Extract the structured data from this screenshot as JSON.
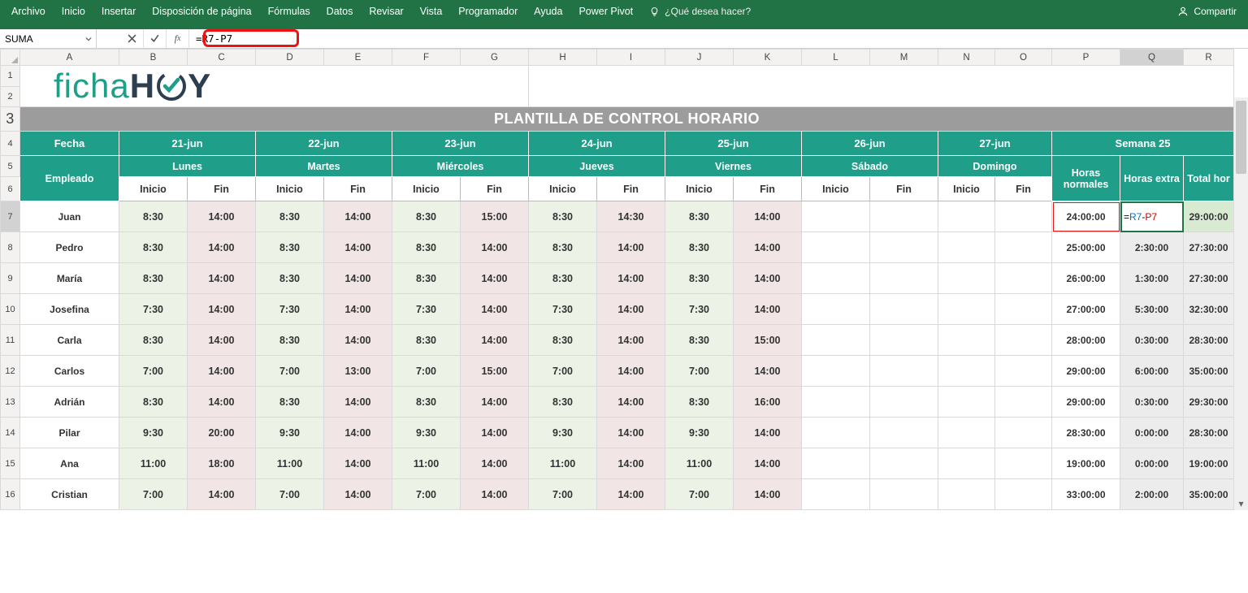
{
  "ribbon": {
    "tabs": [
      "Archivo",
      "Inicio",
      "Insertar",
      "Disposición de página",
      "Fórmulas",
      "Datos",
      "Revisar",
      "Vista",
      "Programador",
      "Ayuda",
      "Power Pivot"
    ],
    "tellMe": "¿Qué desea hacer?",
    "share": "Compartir"
  },
  "formulaBar": {
    "nameBox": "SUMA",
    "formula": "=R7-P7"
  },
  "columns": [
    "A",
    "B",
    "C",
    "D",
    "E",
    "F",
    "G",
    "H",
    "I",
    "J",
    "K",
    "L",
    "M",
    "N",
    "O",
    "P",
    "Q",
    "R"
  ],
  "logo": {
    "part1": "ficha",
    "part2": "H",
    "part3": "Y"
  },
  "title": "PLANTILLA DE CONTROL HORARIO",
  "headerDates": {
    "fecha": "Fecha",
    "dates": [
      "21-jun",
      "22-jun",
      "23-jun",
      "24-jun",
      "25-jun",
      "26-jun",
      "27-jun"
    ],
    "week": "Semana 25"
  },
  "headerDays": {
    "empleado": "Empleado",
    "days": [
      "Lunes",
      "Martes",
      "Miércoles",
      "Jueves",
      "Viernes",
      "Sábado",
      "Domingo"
    ],
    "horasNorm": "Horas normales",
    "horasExtra": "Horas extra",
    "totalHoras": "Total hor"
  },
  "subHeaders": {
    "inicio": "Inicio",
    "fin": "Fin"
  },
  "activeFormulaDisplay": {
    "eq": "=",
    "ref1": "R7",
    "minus": "-",
    "ref2": "P7"
  },
  "rows": [
    {
      "n": "7",
      "emp": "Juan",
      "t": [
        [
          "8:30",
          "14:00"
        ],
        [
          "8:30",
          "14:00"
        ],
        [
          "8:30",
          "15:00"
        ],
        [
          "8:30",
          "14:30"
        ],
        [
          "8:30",
          "14:00"
        ],
        [
          "",
          ""
        ],
        [
          "",
          ""
        ]
      ],
      "hn": "24:00:00",
      "he": "",
      "th": "29:00:00",
      "active": true
    },
    {
      "n": "8",
      "emp": "Pedro",
      "t": [
        [
          "8:30",
          "14:00"
        ],
        [
          "8:30",
          "14:00"
        ],
        [
          "8:30",
          "14:00"
        ],
        [
          "8:30",
          "14:00"
        ],
        [
          "8:30",
          "14:00"
        ],
        [
          "",
          ""
        ],
        [
          "",
          ""
        ]
      ],
      "hn": "25:00:00",
      "he": "2:30:00",
      "th": "27:30:00"
    },
    {
      "n": "9",
      "emp": "María",
      "t": [
        [
          "8:30",
          "14:00"
        ],
        [
          "8:30",
          "14:00"
        ],
        [
          "8:30",
          "14:00"
        ],
        [
          "8:30",
          "14:00"
        ],
        [
          "8:30",
          "14:00"
        ],
        [
          "",
          ""
        ],
        [
          "",
          ""
        ]
      ],
      "hn": "26:00:00",
      "he": "1:30:00",
      "th": "27:30:00"
    },
    {
      "n": "10",
      "emp": "Josefina",
      "t": [
        [
          "7:30",
          "14:00"
        ],
        [
          "7:30",
          "14:00"
        ],
        [
          "7:30",
          "14:00"
        ],
        [
          "7:30",
          "14:00"
        ],
        [
          "7:30",
          "14:00"
        ],
        [
          "",
          ""
        ],
        [
          "",
          ""
        ]
      ],
      "hn": "27:00:00",
      "he": "5:30:00",
      "th": "32:30:00"
    },
    {
      "n": "11",
      "emp": "Carla",
      "t": [
        [
          "8:30",
          "14:00"
        ],
        [
          "8:30",
          "14:00"
        ],
        [
          "8:30",
          "14:00"
        ],
        [
          "8:30",
          "14:00"
        ],
        [
          "8:30",
          "15:00"
        ],
        [
          "",
          ""
        ],
        [
          "",
          ""
        ]
      ],
      "hn": "28:00:00",
      "he": "0:30:00",
      "th": "28:30:00"
    },
    {
      "n": "12",
      "emp": "Carlos",
      "t": [
        [
          "7:00",
          "14:00"
        ],
        [
          "7:00",
          "13:00"
        ],
        [
          "7:00",
          "15:00"
        ],
        [
          "7:00",
          "14:00"
        ],
        [
          "7:00",
          "14:00"
        ],
        [
          "",
          ""
        ],
        [
          "",
          ""
        ]
      ],
      "hn": "29:00:00",
      "he": "6:00:00",
      "th": "35:00:00"
    },
    {
      "n": "13",
      "emp": "Adrián",
      "t": [
        [
          "8:30",
          "14:00"
        ],
        [
          "8:30",
          "14:00"
        ],
        [
          "8:30",
          "14:00"
        ],
        [
          "8:30",
          "14:00"
        ],
        [
          "8:30",
          "16:00"
        ],
        [
          "",
          ""
        ],
        [
          "",
          ""
        ]
      ],
      "hn": "29:00:00",
      "he": "0:30:00",
      "th": "29:30:00"
    },
    {
      "n": "14",
      "emp": "Pilar",
      "t": [
        [
          "9:30",
          "20:00"
        ],
        [
          "9:30",
          "14:00"
        ],
        [
          "9:30",
          "14:00"
        ],
        [
          "9:30",
          "14:00"
        ],
        [
          "9:30",
          "14:00"
        ],
        [
          "",
          ""
        ],
        [
          "",
          ""
        ]
      ],
      "hn": "28:30:00",
      "he": "0:00:00",
      "th": "28:30:00"
    },
    {
      "n": "15",
      "emp": "Ana",
      "t": [
        [
          "11:00",
          "18:00"
        ],
        [
          "11:00",
          "14:00"
        ],
        [
          "11:00",
          "14:00"
        ],
        [
          "11:00",
          "14:00"
        ],
        [
          "11:00",
          "14:00"
        ],
        [
          "",
          ""
        ],
        [
          "",
          ""
        ]
      ],
      "hn": "19:00:00",
      "he": "0:00:00",
      "th": "19:00:00"
    },
    {
      "n": "16",
      "emp": "Cristian",
      "t": [
        [
          "7:00",
          "14:00"
        ],
        [
          "7:00",
          "14:00"
        ],
        [
          "7:00",
          "14:00"
        ],
        [
          "7:00",
          "14:00"
        ],
        [
          "7:00",
          "14:00"
        ],
        [
          "",
          ""
        ],
        [
          "",
          ""
        ]
      ],
      "hn": "33:00:00",
      "he": "2:00:00",
      "th": "35:00:00"
    }
  ]
}
